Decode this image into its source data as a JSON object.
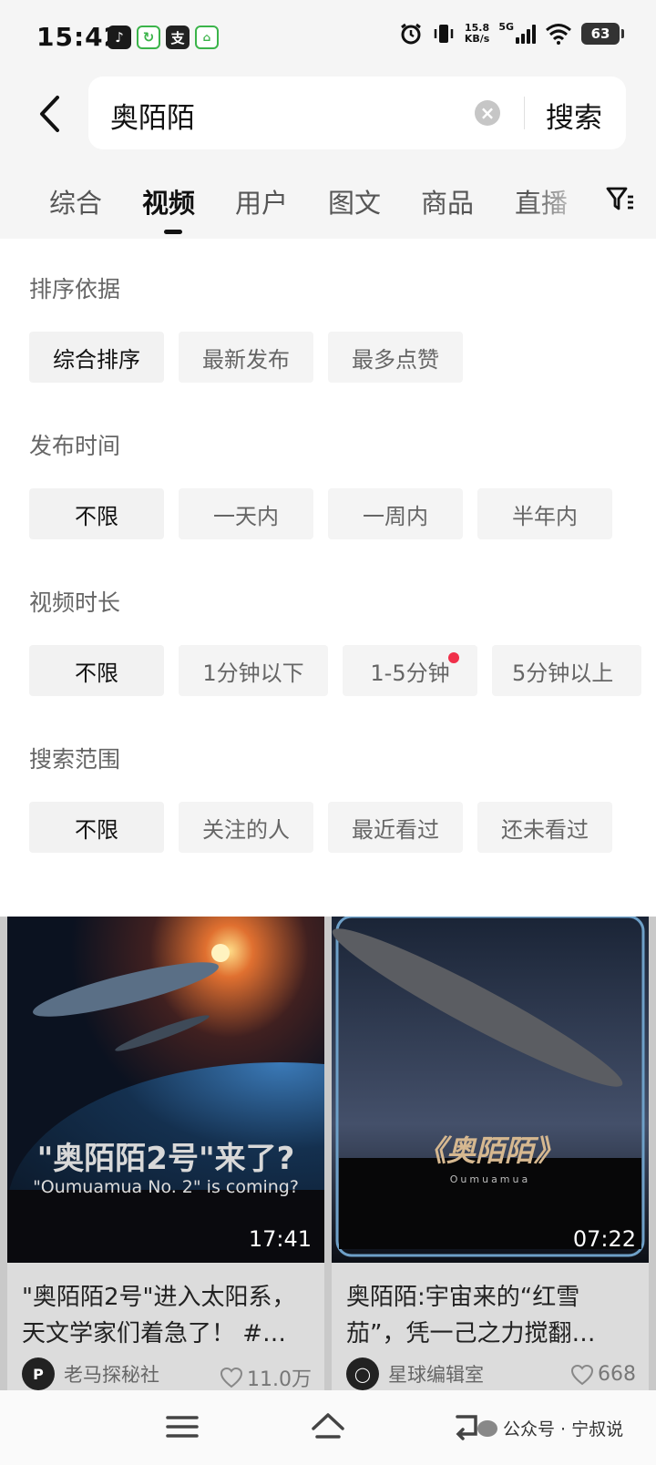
{
  "status_bar": {
    "time": "15:42",
    "net_speed_value": "15.8",
    "net_speed_unit": "KB/s",
    "network": "5G",
    "battery": "63"
  },
  "search": {
    "query": "奥陌陌",
    "button_label": "搜索"
  },
  "tabs": [
    {
      "label": "综合",
      "active": false
    },
    {
      "label": "视频",
      "active": true
    },
    {
      "label": "用户",
      "active": false
    },
    {
      "label": "图文",
      "active": false
    },
    {
      "label": "商品",
      "active": false
    },
    {
      "label": "直播",
      "active": false
    }
  ],
  "filters": {
    "sort": {
      "title": "排序依据",
      "options": [
        "综合排序",
        "最新发布",
        "最多点赞"
      ],
      "selected": "综合排序"
    },
    "publish_time": {
      "title": "发布时间",
      "options": [
        "不限",
        "一天内",
        "一周内",
        "半年内"
      ],
      "selected": "不限"
    },
    "duration": {
      "title": "视频时长",
      "options": [
        "不限",
        "1分钟以下",
        "1-5分钟",
        "5分钟以上"
      ],
      "selected": "不限"
    },
    "scope": {
      "title": "搜索范围",
      "options": [
        "不限",
        "关注的人",
        "最近看过",
        "还未看过"
      ],
      "selected": "不限"
    }
  },
  "results": [
    {
      "thumb_headline": "\"奥陌陌2号\"来了?",
      "thumb_subline": "\"Oumuamua No. 2\" is coming?",
      "duration": "17:41",
      "title": "\"奥陌陌2号\"进入太阳系，天文学家们着急了！ #…",
      "author": "老马探秘社",
      "likes": "11.0万"
    },
    {
      "thumb_headline": "《奥陌陌》",
      "thumb_subline": "Oumuamua",
      "duration": "07:22",
      "title": "奥陌陌:宇宙来的“红雪茄”，凭一己之力搅翻…",
      "author": "星球编辑室",
      "likes": "668"
    }
  ],
  "watermark": "公众号 · 宁叔说"
}
